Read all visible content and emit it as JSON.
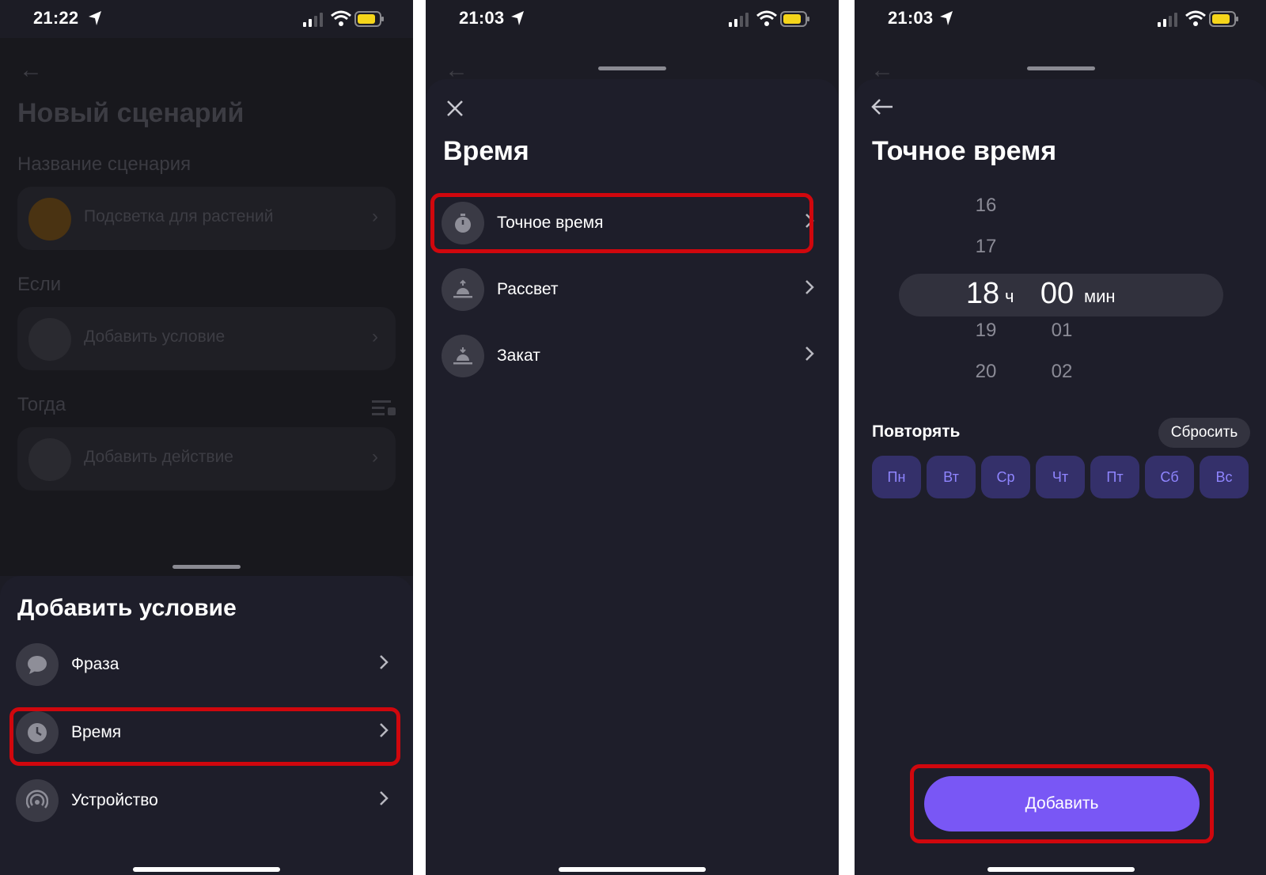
{
  "colors": {
    "accent": "#7957f5",
    "highlight": "#d0070d",
    "day_text": "#8f85ff"
  },
  "panel1": {
    "status": {
      "time": "21:22"
    },
    "background": {
      "title": "Новый сценарий",
      "name_label": "Название сценария",
      "name_value": "Подсветка для растений",
      "if_label": "Если",
      "add_condition": "Добавить условие",
      "then_label": "Тогда",
      "add_action": "Добавить действие"
    },
    "sheet": {
      "title": "Добавить условие",
      "items": [
        {
          "label": "Фраза",
          "icon": "chat-bubble-icon"
        },
        {
          "label": "Время",
          "icon": "clock-icon"
        },
        {
          "label": "Устройство",
          "icon": "device-signal-icon"
        }
      ]
    }
  },
  "panel2": {
    "status": {
      "time": "21:03"
    },
    "sheet": {
      "title": "Время",
      "items": [
        {
          "label": "Точное время",
          "icon": "stopwatch-icon"
        },
        {
          "label": "Рассвет",
          "icon": "sunrise-icon"
        },
        {
          "label": "Закат",
          "icon": "sunset-icon"
        }
      ]
    }
  },
  "panel3": {
    "status": {
      "time": "21:03"
    },
    "sheet": {
      "title": "Точное время",
      "hours": [
        "16",
        "17",
        "18",
        "19",
        "20"
      ],
      "minutes": [
        "00",
        "01",
        "02"
      ],
      "hour_unit": "ч",
      "minute_unit": "мин",
      "repeat_label": "Повторять",
      "reset_label": "Сбросить",
      "days": [
        "Пн",
        "Вт",
        "Ср",
        "Чт",
        "Пт",
        "Сб",
        "Вс"
      ],
      "add_label": "Добавить"
    }
  }
}
